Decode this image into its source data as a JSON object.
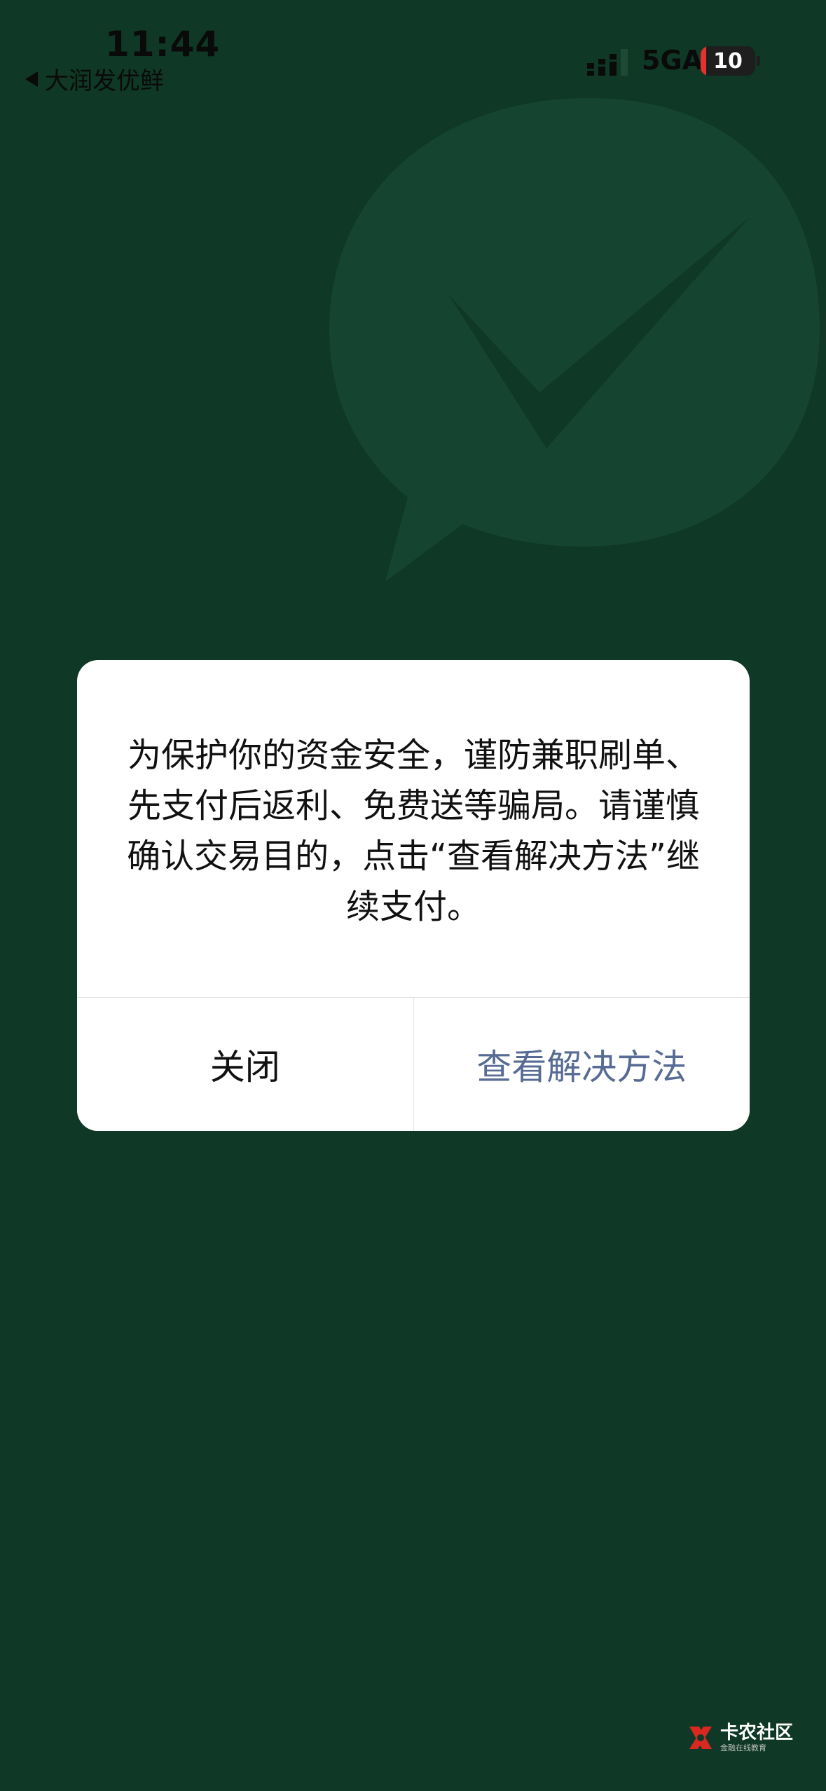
{
  "status_bar": {
    "time": "11:44",
    "back_app": "大润发优鲜",
    "network": "5GA",
    "battery_level": "10"
  },
  "dialog": {
    "message": "为保护你的资金安全，谨防兼职刷单、先支付后返利、免费送等骗局。请谨慎确认交易目的，点击“查看解决方法”继续支付。",
    "close_label": "关闭",
    "confirm_label": "查看解决方法"
  },
  "watermark_logo": {
    "title": "卡农社区",
    "subtitle": "金融在线教育"
  },
  "colors": {
    "background": "#0f3826",
    "dialog_bg": "#ffffff",
    "confirm_text": "#576b95",
    "close_text": "#111111"
  }
}
